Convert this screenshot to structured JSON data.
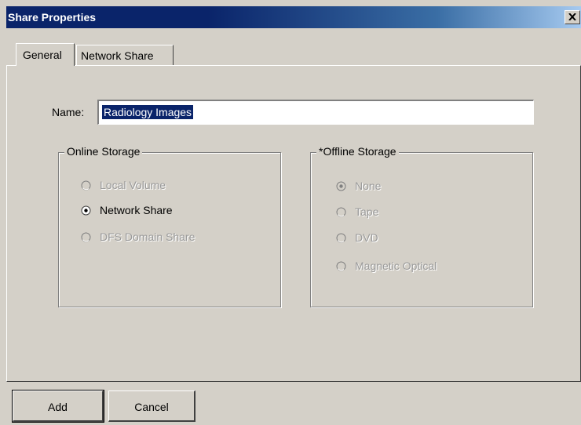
{
  "window": {
    "title": "Share Properties"
  },
  "tabs": [
    {
      "label": "General",
      "active": true
    },
    {
      "label": "Network Share",
      "active": false
    }
  ],
  "name_field": {
    "label": "Name:",
    "value": "Radiology Images"
  },
  "online_storage": {
    "title": "Online Storage",
    "options": [
      {
        "label": "Local Volume",
        "selected": false,
        "enabled": false
      },
      {
        "label": "Network Share",
        "selected": true,
        "enabled": true
      },
      {
        "label": "DFS Domain Share",
        "selected": false,
        "enabled": false
      }
    ]
  },
  "offline_storage": {
    "title": "*Offline Storage",
    "options": [
      {
        "label": "None",
        "selected": true,
        "enabled": false
      },
      {
        "label": "Tape",
        "selected": false,
        "enabled": false
      },
      {
        "label": "DVD",
        "selected": false,
        "enabled": false
      },
      {
        "label": "Magnetic Optical",
        "selected": false,
        "enabled": false
      }
    ]
  },
  "buttons": {
    "add": "Add",
    "cancel": "Cancel"
  },
  "colors": {
    "face": "#d4d0c8",
    "titlebar": "#0a246a",
    "selection": "#0a246a",
    "disabled_text": "#9a9a9a"
  }
}
